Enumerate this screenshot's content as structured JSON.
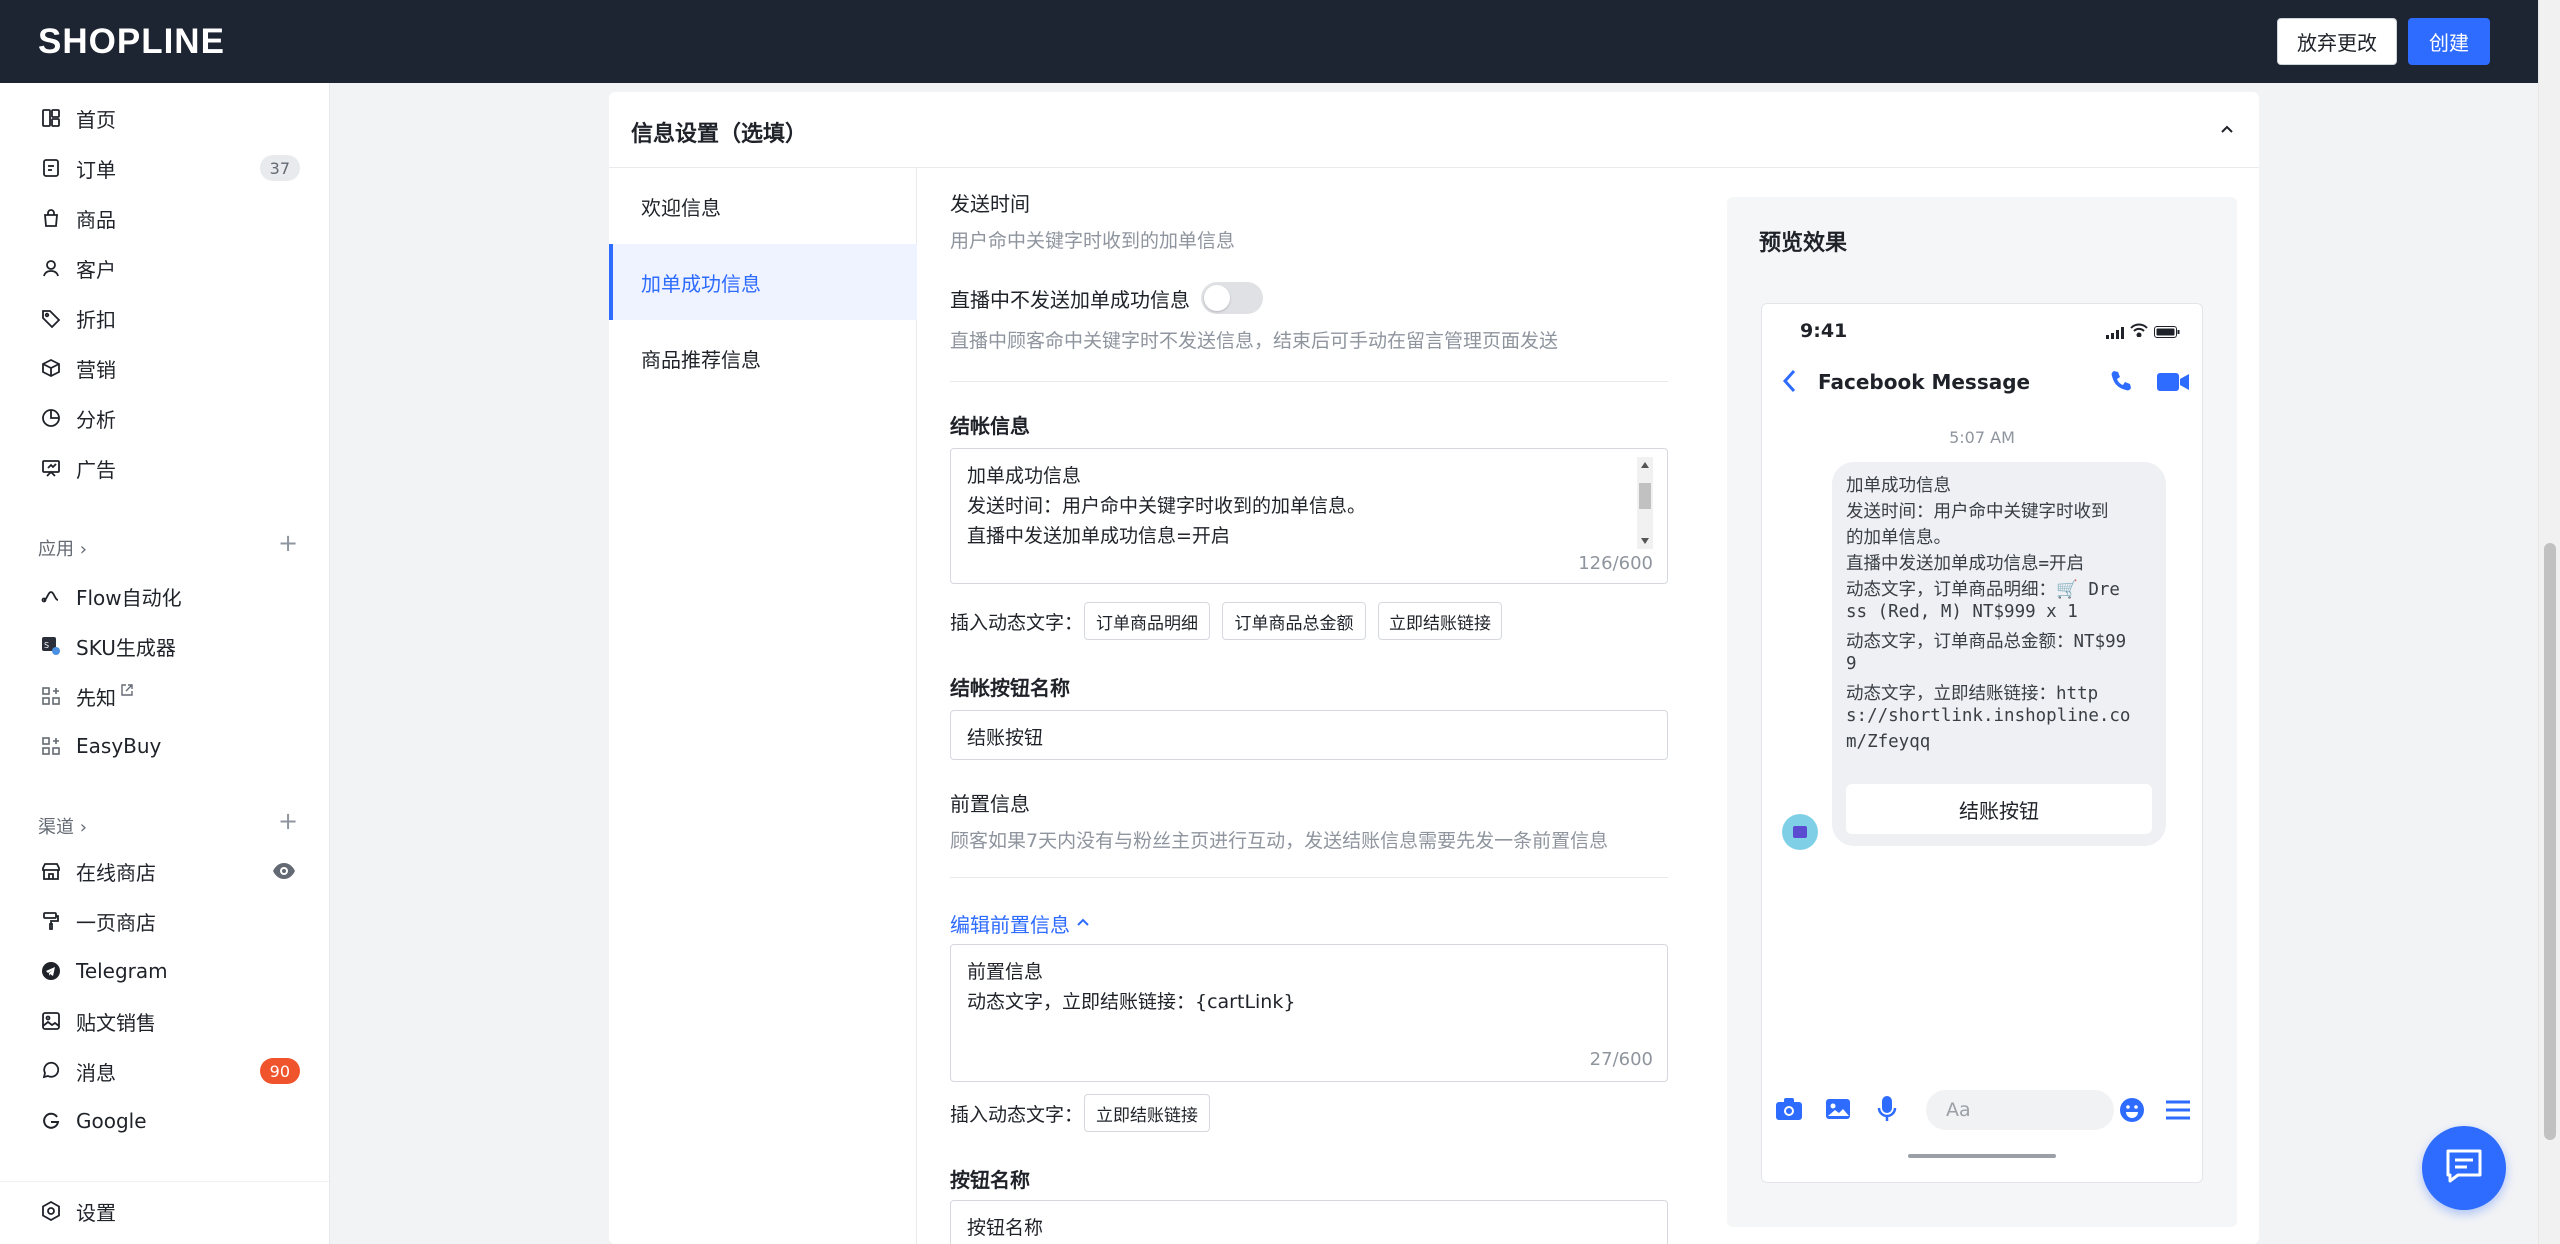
{
  "header": {
    "logo": "SHOPLINE",
    "discard_label": "放弃更改",
    "create_label": "创建"
  },
  "sidebar": {
    "items": [
      {
        "label": "首页",
        "icon": "dashboard-icon"
      },
      {
        "label": "订单",
        "icon": "order-icon",
        "count": "37"
      },
      {
        "label": "商品",
        "icon": "bag-icon"
      },
      {
        "label": "客户",
        "icon": "person-icon"
      },
      {
        "label": "折扣",
        "icon": "tag-icon"
      },
      {
        "label": "营销",
        "icon": "box-icon"
      },
      {
        "label": "分析",
        "icon": "pie-chart-icon"
      },
      {
        "label": "广告",
        "icon": "billboard-icon"
      }
    ],
    "apps_section": "应用 ›",
    "apps": [
      {
        "label": "Flow自动化",
        "icon": "flow-icon"
      },
      {
        "label": "SKU生成器",
        "icon": "sku-icon"
      },
      {
        "label": "先知",
        "icon": "apps-icon",
        "external": true
      },
      {
        "label": "EasyBuy",
        "icon": "apps-icon"
      }
    ],
    "channels_section": "渠道 ›",
    "channels": [
      {
        "label": "在线商店",
        "icon": "store-icon"
      },
      {
        "label": "一页商店",
        "icon": "paint-roller-icon"
      },
      {
        "label": "Telegram",
        "icon": "telegram-icon"
      },
      {
        "label": "贴文销售",
        "icon": "image-post-icon"
      },
      {
        "label": "消息",
        "icon": "chat-icon",
        "count": "90"
      },
      {
        "label": "Google",
        "icon": "google-icon"
      }
    ],
    "settings": "设置",
    "accent_color": "#2e6bff",
    "badge_red": "#f0542d"
  },
  "card": {
    "title": "信息设置（选填）",
    "menu": [
      "欢迎信息",
      "加单成功信息",
      "商品推荐信息"
    ],
    "active_menu_index": 1
  },
  "form": {
    "send_time_label": "发送时间",
    "send_time_help": "用户命中关键字时收到的加单信息",
    "live_toggle_label": "直播中不发送加单成功信息",
    "live_toggle_on": false,
    "live_toggle_help": "直播中顾客命中关键字时不发送信息，结束后可手动在留言管理页面发送",
    "checkout_msg_label": "结帐信息",
    "checkout_msg_lines": [
      "加单成功信息",
      "发送时间：用户命中关键字时收到的加单信息。",
      "直播中发送加单成功信息=开启"
    ],
    "checkout_msg_count": "126/600",
    "insert_label": "插入动态文字：",
    "chips": [
      "订单商品明细",
      "订单商品总金额",
      "立即结账链接"
    ],
    "checkout_btn_label": "结帐按钮名称",
    "checkout_btn_value": "结账按钮",
    "pre_msg_label": "前置信息",
    "pre_msg_help": "顾客如果7天内没有与粉丝主页进行互动，发送结账信息需要先发一条前置信息",
    "edit_pre_link": "编辑前置信息",
    "pre_msg_lines": [
      "前置信息",
      "动态文字，立即结账链接：{cartLink}"
    ],
    "pre_msg_count": "27/600",
    "pre_chip": "立即结账链接",
    "btn_name_label": "按钮名称",
    "btn_name_value": "按钮名称"
  },
  "preview": {
    "title": "预览效果",
    "status_time": "9:41",
    "chat_title": "Facebook Message",
    "timestamp": "5:07 AM",
    "bubble_lines": [
      "加单成功信息",
      "发送时间：用户命中关键字时收到",
      "的加单信息。",
      "直播中发送加单成功信息=开启",
      "动态文字，订单商品明细：🛒 Dre",
      "ss (Red, M) NT$999 x 1",
      "动态文字，订单商品总金额：NT$99",
      "9",
      "动态文字，立即结账链接：http",
      "s://shortlink.inshopline.co",
      "m/Zfeyqq"
    ],
    "bubble_button": "结账按钮",
    "input_placeholder": "Aa"
  }
}
